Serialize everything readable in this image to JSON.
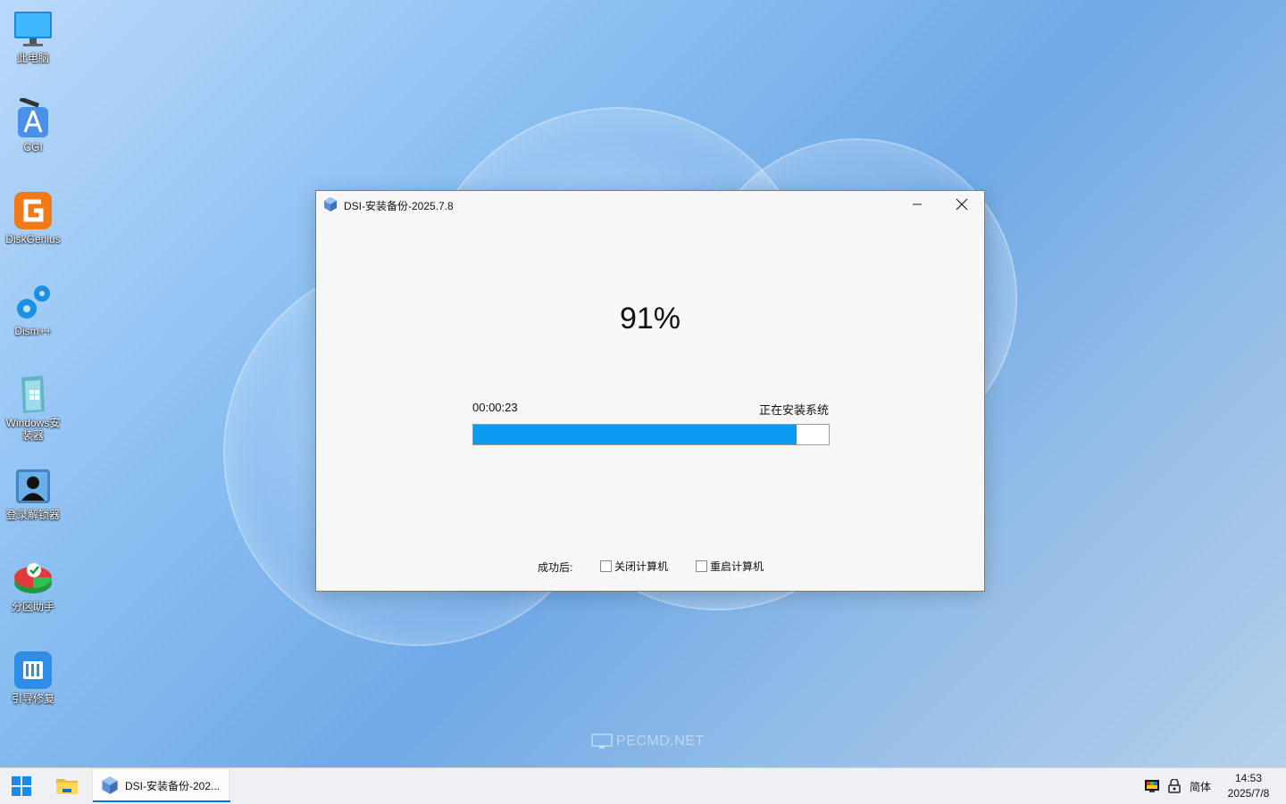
{
  "desktop": {
    "icons": [
      {
        "label": "此电脑"
      },
      {
        "label": "CGI"
      },
      {
        "label": "DiskGenius"
      },
      {
        "label": "Dism++"
      },
      {
        "label": "Windows安装器"
      },
      {
        "label": "登录解锁器"
      },
      {
        "label": "分区助手"
      },
      {
        "label": "引导修复"
      }
    ],
    "watermark": "PECMD.NET"
  },
  "window": {
    "title": "DSI-安装备份-2025.7.8",
    "percent_text": "91%",
    "elapsed": "00:00:23",
    "status": "正在安装系统",
    "progress": 0.91,
    "after_label": "成功后:",
    "options": [
      {
        "label": "关闭计算机",
        "checked": false
      },
      {
        "label": "重启计算机",
        "checked": false
      }
    ]
  },
  "taskbar": {
    "active_app_label": "DSI-安装备份-202...",
    "language": "简体",
    "time": "14:53",
    "date": "2025/7/8"
  },
  "colors": {
    "accent": "#0a9bf0",
    "taskbar_indicator": "#0078d4"
  }
}
